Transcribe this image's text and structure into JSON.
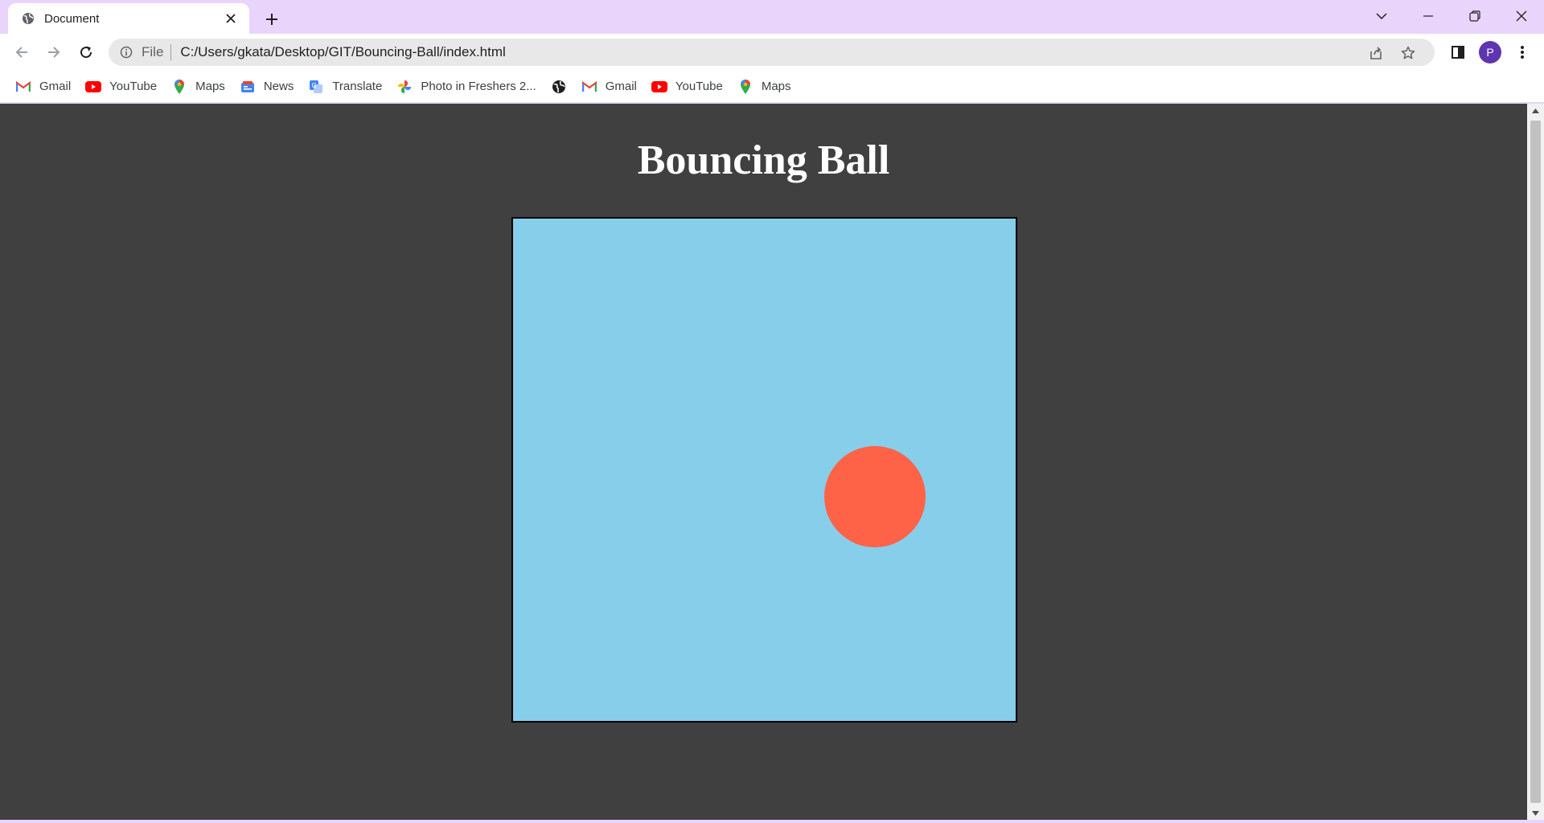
{
  "browser": {
    "tab": {
      "title": "Document",
      "favicon": "globe-icon"
    },
    "address": {
      "scheme": "File",
      "url": "C:/Users/gkata/Desktop/GIT/Bouncing-Ball/index.html"
    },
    "profile_initial": "P",
    "bookmarks": [
      {
        "label": "Gmail",
        "icon": "gmail-icon"
      },
      {
        "label": "YouTube",
        "icon": "youtube-icon"
      },
      {
        "label": "Maps",
        "icon": "maps-icon"
      },
      {
        "label": "News",
        "icon": "news-icon"
      },
      {
        "label": "Translate",
        "icon": "translate-icon"
      },
      {
        "label": "Photo in Freshers 2...",
        "icon": "photos-icon"
      },
      {
        "label": "",
        "icon": "globe-icon"
      },
      {
        "label": "Gmail",
        "icon": "gmail-icon"
      },
      {
        "label": "YouTube",
        "icon": "youtube-icon"
      },
      {
        "label": "Maps",
        "icon": "maps-icon"
      }
    ],
    "colors": {
      "tabstrip": "#e9d5fb",
      "avatar": "#5e35b1"
    }
  },
  "page": {
    "title": "Bouncing Ball",
    "colors": {
      "background": "#404040",
      "stage": "#87ceeb",
      "ball": "#ff6347"
    }
  }
}
